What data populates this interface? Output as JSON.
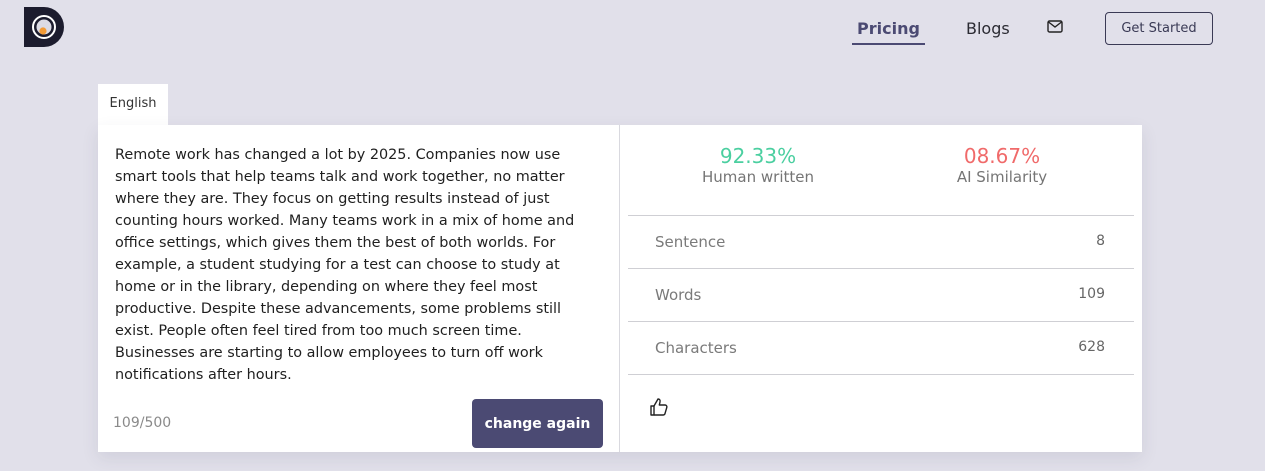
{
  "header": {
    "nav": {
      "pricing": "Pricing",
      "blogs": "Blogs"
    },
    "get_started": "Get Started",
    "icons": {
      "logo": "logo-d-icon",
      "mail": "mail-icon"
    }
  },
  "editor": {
    "language_tab": "English",
    "text": "Remote work has changed a lot by 2025. Companies now use smart tools that help teams talk and work together, no matter where they are. They focus on getting results instead of just counting hours worked. Many teams work in a mix of home and office settings, which gives them the best of both worlds. For example, a student studying for a test can choose to study at home or in the library, depending on where they feel most productive. Despite these advancements, some problems still exist. People often feel tired from too much screen time. Businesses are starting to allow employees to turn off work notifications after hours.",
    "counter": "109/500",
    "change_button": "change again"
  },
  "results": {
    "human": {
      "value": "92.33%",
      "label": "Human written"
    },
    "ai": {
      "value": "08.67%",
      "label": "AI Similarity"
    },
    "stats": [
      {
        "label": "Sentence",
        "value": "8"
      },
      {
        "label": "Words",
        "value": "109"
      },
      {
        "label": "Characters",
        "value": "628"
      }
    ],
    "feedback_icon": "thumbs-up-icon"
  },
  "colors": {
    "background": "#e1e0ea",
    "accent": "#4b4a73",
    "human": "#4bcfa0",
    "ai": "#f06a6a"
  }
}
